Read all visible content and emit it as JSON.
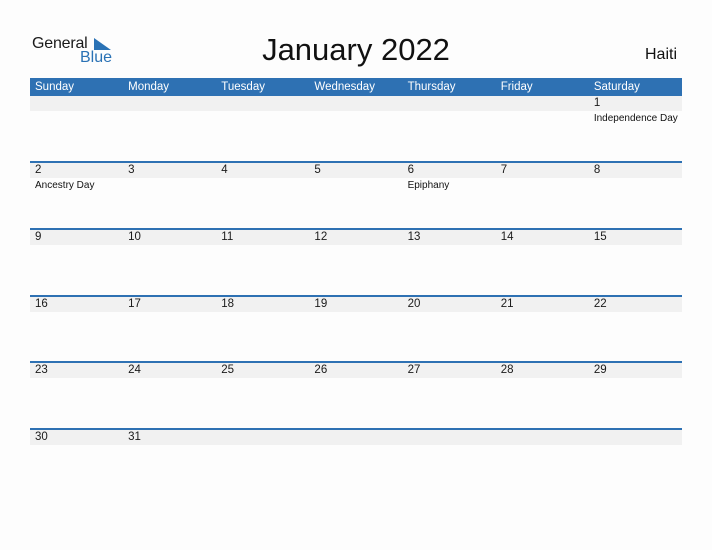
{
  "logo": {
    "line1": "General",
    "line2": "Blue"
  },
  "title": "January 2022",
  "country": "Haiti",
  "colors": {
    "accent": "#2e71b3",
    "date_strip": "#f1f1f1"
  },
  "weekdays": [
    "Sunday",
    "Monday",
    "Tuesday",
    "Wednesday",
    "Thursday",
    "Friday",
    "Saturday"
  ],
  "weeks": [
    [
      {
        "d": ""
      },
      {
        "d": ""
      },
      {
        "d": ""
      },
      {
        "d": ""
      },
      {
        "d": ""
      },
      {
        "d": ""
      },
      {
        "d": "1",
        "e": "Independence Day"
      }
    ],
    [
      {
        "d": "2",
        "e": "Ancestry Day"
      },
      {
        "d": "3"
      },
      {
        "d": "4"
      },
      {
        "d": "5"
      },
      {
        "d": "6",
        "e": "Epiphany"
      },
      {
        "d": "7"
      },
      {
        "d": "8"
      }
    ],
    [
      {
        "d": "9"
      },
      {
        "d": "10"
      },
      {
        "d": "11"
      },
      {
        "d": "12"
      },
      {
        "d": "13"
      },
      {
        "d": "14"
      },
      {
        "d": "15"
      }
    ],
    [
      {
        "d": "16"
      },
      {
        "d": "17"
      },
      {
        "d": "18"
      },
      {
        "d": "19"
      },
      {
        "d": "20"
      },
      {
        "d": "21"
      },
      {
        "d": "22"
      }
    ],
    [
      {
        "d": "23"
      },
      {
        "d": "24"
      },
      {
        "d": "25"
      },
      {
        "d": "26"
      },
      {
        "d": "27"
      },
      {
        "d": "28"
      },
      {
        "d": "29"
      }
    ],
    [
      {
        "d": "30"
      },
      {
        "d": "31"
      },
      {
        "d": ""
      },
      {
        "d": ""
      },
      {
        "d": ""
      },
      {
        "d": ""
      },
      {
        "d": ""
      }
    ]
  ]
}
